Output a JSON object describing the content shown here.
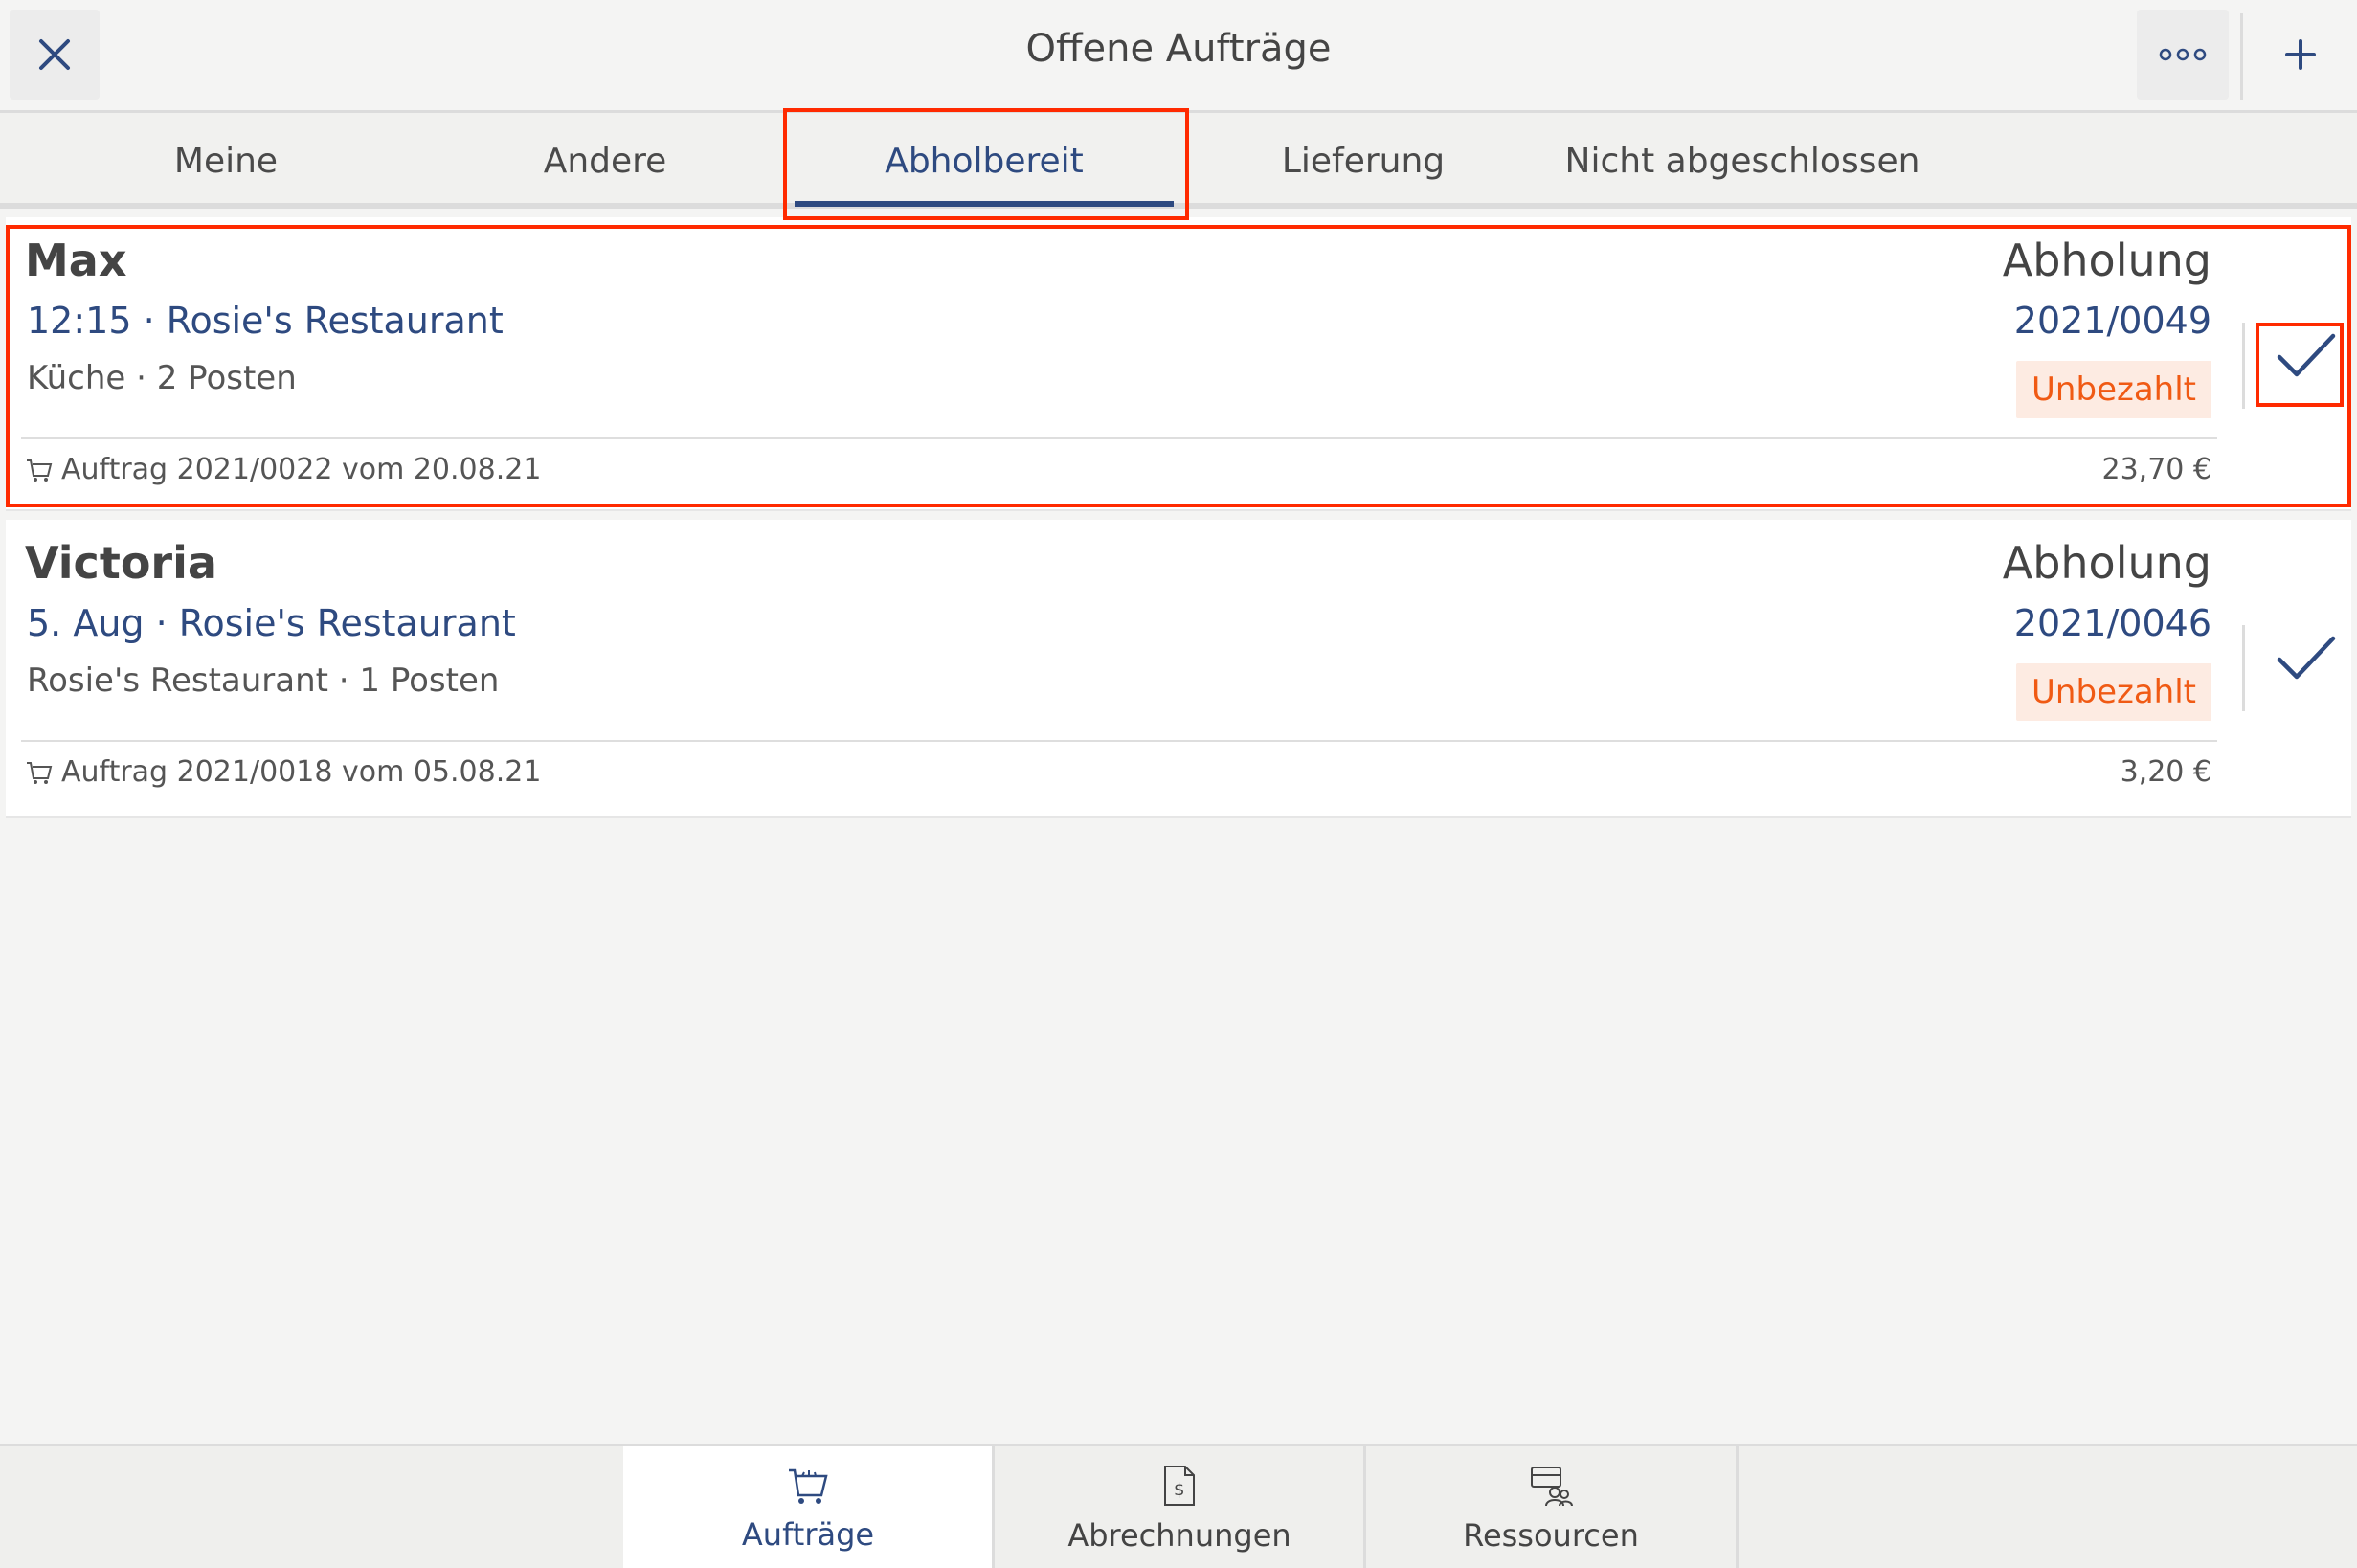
{
  "header": {
    "title": "Offene Aufträge",
    "close_icon": "close-icon",
    "more_icon": "more-icon",
    "add_icon": "plus-icon"
  },
  "tabs": [
    {
      "label": "Meine",
      "active": false
    },
    {
      "label": "Andere",
      "active": false
    },
    {
      "label": "Abholbereit",
      "active": true
    },
    {
      "label": "Lieferung",
      "active": false
    },
    {
      "label": "Nicht abgeschlossen",
      "active": false
    }
  ],
  "orders": [
    {
      "name": "Max",
      "time_location": "12:15 · Rosie's Restaurant",
      "detail": "Küche · 2 Posten",
      "kind": "Abholung",
      "number": "2021/0049",
      "payment_status": "Unbezahlt",
      "reference": "Auftrag 2021/0022 vom 20.08.21",
      "amount": "23,70 €"
    },
    {
      "name": "Victoria",
      "time_location": "5. Aug · Rosie's Restaurant",
      "detail": "Rosie's Restaurant · 1 Posten",
      "kind": "Abholung",
      "number": "2021/0046",
      "payment_status": "Unbezahlt",
      "reference": "Auftrag 2021/0018 vom 05.08.21",
      "amount": "3,20 €"
    }
  ],
  "bottom_nav": [
    {
      "label": "Aufträge",
      "icon": "cart-icon",
      "active": true
    },
    {
      "label": "Abrechnungen",
      "icon": "invoice-icon",
      "active": false
    },
    {
      "label": "Ressourcen",
      "icon": "resources-icon",
      "active": false
    }
  ],
  "colors": {
    "accent": "#2e4a80",
    "unpaid_text": "#f05a14",
    "unpaid_bg": "#fdebe2",
    "highlight": "#ff2a00"
  }
}
